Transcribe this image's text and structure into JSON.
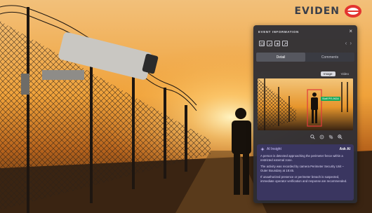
{
  "brand": {
    "name": "EVIDEN"
  },
  "panel": {
    "header": "EVENT INFORMATION",
    "close_glyph": "×",
    "toolbar_icons": [
      "image-icon",
      "check-icon",
      "stop-icon",
      "share-icon"
    ],
    "nav": {
      "prev": "‹",
      "next": "›"
    },
    "tabs": [
      {
        "label": "Detail",
        "active": true
      },
      {
        "label": "Comments",
        "active": false
      }
    ],
    "media_tabs": [
      {
        "label": "Image",
        "active": true
      },
      {
        "label": "Video",
        "active": false
      }
    ],
    "detection_label": "Staff PR-9634",
    "preview_controls": [
      "zoom-out-icon",
      "reset-icon",
      "crop-icon",
      "zoom-in-icon"
    ],
    "insight": {
      "title": "AI Insight",
      "ask_label": "Ask AI",
      "paragraphs": [
        "A person is detected approaching the perimeter fence within a restricted external zone.",
        "The activity was recorded by camera Perimeter Security Unit – Outer Boundary at 18:45.",
        "If unauthorized presence or perimeter breach is suspected, immediate operator verification and response are recommended."
      ]
    }
  },
  "colors": {
    "accent": "#cfc6ff",
    "detection": "#e23b3b",
    "tag": "#1aa75a",
    "brand_logo": "#e3342f"
  }
}
